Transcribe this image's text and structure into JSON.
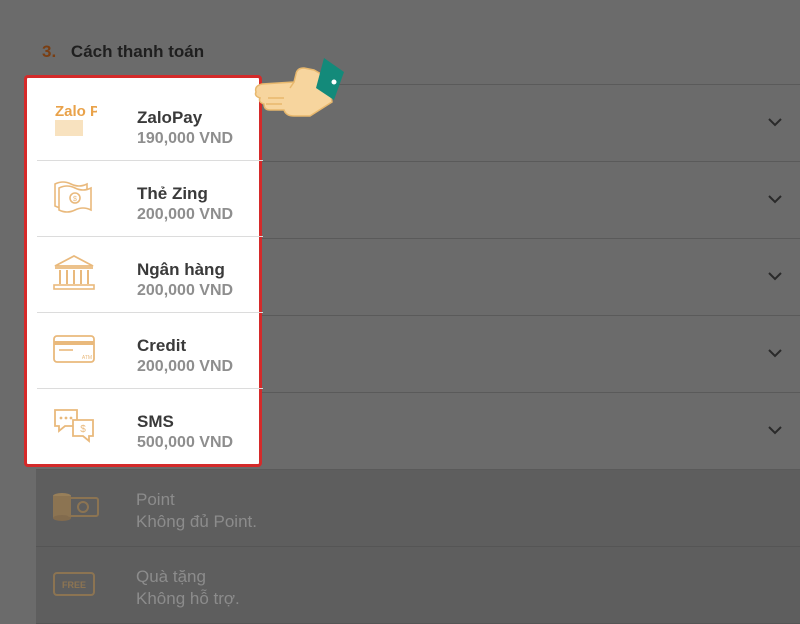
{
  "section": {
    "number": "3.",
    "title": "Cách thanh toán"
  },
  "methods": [
    {
      "name": "ZaloPay",
      "amount": "190,000 VND",
      "icon": "zalopay-logo-icon",
      "logo_text": "Zalo Pay"
    },
    {
      "name": "Thẻ Zing",
      "amount": "200,000 VND",
      "icon": "zing-card-icon"
    },
    {
      "name": "Ngân hàng",
      "amount": "200,000 VND",
      "icon": "bank-icon"
    },
    {
      "name": "Credit",
      "amount": "200,000 VND",
      "icon": "credit-card-icon",
      "card_text": "ATM"
    },
    {
      "name": "SMS",
      "amount": "500,000 VND",
      "icon": "sms-chat-icon"
    }
  ],
  "disabled_methods": [
    {
      "name": "Point",
      "status": "Không đủ Point.",
      "icon": "coins-icon"
    },
    {
      "name": "Quà tặng",
      "status": "Không hỗ trợ.",
      "icon": "free-gift-icon",
      "badge_text": "FREE"
    }
  ],
  "colors": {
    "accent": "#f0a64a",
    "highlight_border": "#d42a2a",
    "icon_tint": "#e9b97c",
    "overlay": "#6b6b6b"
  },
  "pointer": "pointing-hand-icon"
}
